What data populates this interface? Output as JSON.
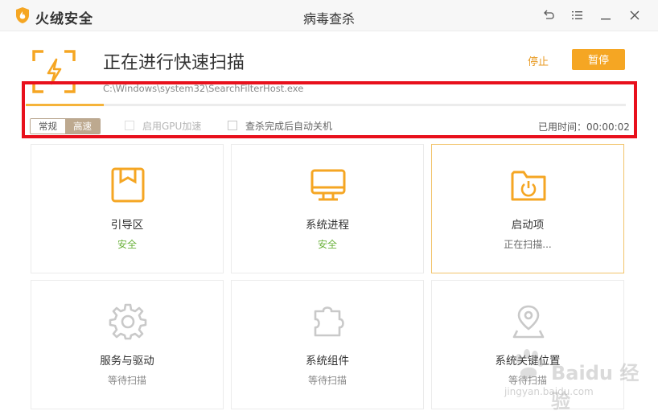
{
  "app": {
    "brand": "火绒安全",
    "window_title": "病毒查杀"
  },
  "titlebar_buttons": [
    {
      "name": "back-icon"
    },
    {
      "name": "menu-icon"
    },
    {
      "name": "minimize-icon"
    },
    {
      "name": "close-icon"
    }
  ],
  "scan": {
    "title": "正在进行快速扫描",
    "current_path": "C:\\Windows\\system32\\SearchFilterHost.exe",
    "stop_label": "停止",
    "pause_label": "暂停",
    "progress": 0.13
  },
  "options": {
    "mode_normal": "常规",
    "mode_fast": "高速",
    "gpu_label": "启用GPU加速",
    "shutdown_label": "查杀完成后自动关机",
    "elapsed": "已用时间：00:00:02"
  },
  "cards": [
    {
      "name": "引导区",
      "status": "安全"
    },
    {
      "name": "系统进程",
      "status": "安全"
    },
    {
      "name": "启动项",
      "status": "正在扫描..."
    },
    {
      "name": "服务与驱动",
      "status": "等待扫描"
    },
    {
      "name": "系统组件",
      "status": "等待扫描"
    },
    {
      "name": "系统关键位置",
      "status": "等待扫描"
    }
  ],
  "watermark": {
    "main": "Baidu 经验",
    "sub": "jingyan.baidu.com"
  },
  "colors": {
    "accent": "#f5a623",
    "safe": "#6db33f",
    "highlight": "#e8101c"
  }
}
